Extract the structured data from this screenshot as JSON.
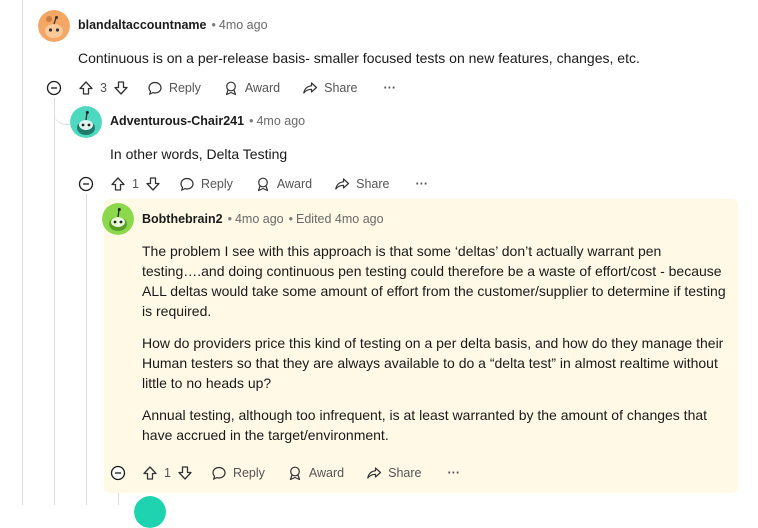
{
  "comments": [
    {
      "username": "blandaltaccountname",
      "time": "4mo ago",
      "edited": "",
      "paragraphs": [
        "Continuous is on a per-release basis- smaller focused tests on new features, changes, etc."
      ],
      "votes": "3",
      "avatar_color": "#f4a765"
    },
    {
      "username": "Adventurous-Chair241",
      "time": "4mo ago",
      "edited": "",
      "paragraphs": [
        "In other words, Delta Testing"
      ],
      "votes": "1",
      "avatar_color": "#4fd8c0"
    },
    {
      "username": "Bobthebrain2",
      "time": "4mo ago",
      "edited": "Edited 4mo ago",
      "paragraphs": [
        "The problem I see with this approach is that some ‘deltas’ don’t actually warrant pen testing….and doing continuous pen testing could therefore be a waste of effort/cost - because ALL deltas would take some amount of effort from the customer/supplier to determine if testing is required.",
        "How do providers price this kind of testing on a per delta basis, and how do they manage their Human testers so that they are always available to do a “delta test” in almost realtime without little to no heads up?",
        "Annual testing, although too infrequent, is at least warranted by the amount of changes that have accrued in the target/environment."
      ],
      "votes": "1",
      "avatar_color": "#8bd84a"
    }
  ],
  "actions": {
    "reply": "Reply",
    "award": "Award",
    "share": "Share",
    "more": "···"
  },
  "colors": {
    "highlight_bg": "#fff9e6",
    "thread_line": "#dadde0",
    "next_avatar": "#1ed4b0"
  }
}
